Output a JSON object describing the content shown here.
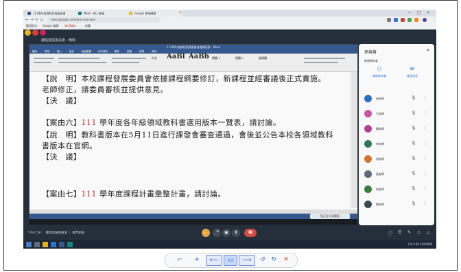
{
  "browser": {
    "tabs": [
      "111學年度課程發展委員會",
      "Meet - 線上會議",
      "Google 雲端硬碟"
    ],
    "new_tab": "+",
    "controls": [
      "−",
      "□",
      "×"
    ],
    "nav": [
      "←",
      "→",
      "↻",
      "⌂"
    ],
    "url": "meet.google.com/hpm-aeju-whx",
    "bookmarks": [
      "應用程式",
      "Google 翻譯",
      "YouTube",
      "地圖"
    ]
  },
  "meet": {
    "presentation_title": "課程發展委員會 - 簡報",
    "presenting_badge": "您正在分享畫面",
    "bottom_left": "下午2:58 ｜ 課程發展委員會 ｜ 教學組長",
    "controls": {
      "mic": "🎤",
      "camera": "▣",
      "present": "⬆",
      "more": "⋮",
      "hangup": "☎"
    },
    "right_controls": [
      "ⓘ",
      "☰",
      "✎",
      "⚠",
      "△"
    ]
  },
  "word": {
    "window_title": "111學年度課程發展委員會會議紀錄 - Word",
    "menu": [
      "檔案",
      "常用",
      "插入",
      "設計",
      "版面配置",
      "參考資料",
      "郵件",
      "校閱",
      "檢視",
      "說明"
    ],
    "styles": [
      "內文",
      "AaBl",
      "AaBb",
      "標題 1",
      "標題 2",
      "副標題"
    ],
    "lines": [
      {
        "prefix": "【說　明】",
        "red": "",
        "text": "本校課程發展委員會依據課程綱要修訂，新課程並經審議後正式實施。"
      },
      {
        "prefix": "",
        "red": "",
        "text": "老師修正，請委員審核並提供意見。"
      },
      {
        "prefix": "【決　議】",
        "red": "",
        "text": ""
      },
      {
        "prefix": "【案由六】",
        "red": "111",
        "text": " 學年度各年級領域教科書選用版本一覽表，請討論。"
      },
      {
        "prefix": "【說　明】",
        "red": "",
        "text": "教科書版本在5月11日進行課發會審查通過，會後並公告本校各領域教科"
      },
      {
        "prefix": "",
        "red": "",
        "text": "書版本在官網。"
      },
      {
        "prefix": "【決　議】",
        "red": "",
        "text": ""
      },
      {
        "prefix": "【案由七】",
        "red": "111",
        "text": " 學年度課程計畫彙整計畫，請討論。"
      }
    ]
  },
  "panel": {
    "title": "參與者",
    "close": "×",
    "subtitle": "新增參與者",
    "actions": [
      "新增參與者",
      "發送訊息"
    ],
    "participants": [
      {
        "name": "林老師",
        "color": "#1e6fd9"
      },
      {
        "name": "王老師",
        "color": "#d94fb0"
      },
      {
        "name": "陳老師",
        "color": "#c2399a"
      },
      {
        "name": "李老師",
        "color": "#1f7a4a"
      },
      {
        "name": "張老師",
        "color": "#e2711d"
      },
      {
        "name": "黃老師",
        "color": "#5a6778"
      },
      {
        "name": "吳老師",
        "color": "#2e7d32"
      },
      {
        "name": "劉老師",
        "color": "#37474f"
      }
    ],
    "mic_icon": "🎙",
    "more_icon": "⋮"
  },
  "taskbar": {
    "clock": "下午2:58\n2022/6/8"
  },
  "viewer": {
    "zoom_label": "⌕·",
    "buttons": [
      "⟵",
      "▭",
      "⟶",
      "↺",
      "↻",
      "✕"
    ],
    "plus": "+"
  }
}
